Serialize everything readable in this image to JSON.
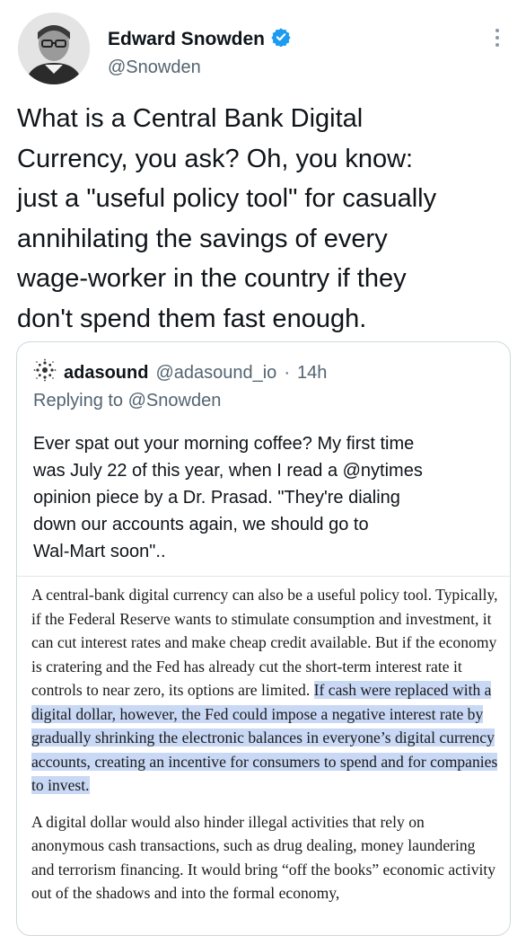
{
  "author": {
    "name": "Edward Snowden",
    "handle": "@Snowden",
    "verified_icon": "verified-badge-icon",
    "colors": {
      "verified": "#1d9bf0"
    }
  },
  "tweet": {
    "text": "What is a Central Bank Digital\nCurrency, you ask? Oh, you know:\njust a \"useful policy tool\" for casually\nannihilating the savings of every\nwage-worker in the country if they\ndon't spend them fast enough."
  },
  "quote": {
    "name": "adasound",
    "handle": "@adasound_io",
    "separator": "·",
    "time": "14h",
    "replying_prefix": "Replying to ",
    "replying_to": "@Snowden",
    "text": "Ever spat out your morning coffee?  My first time\nwas July 22 of this year, when I read a @nytimes\nopinion piece by a Dr. Prasad.  \"They're dialing\ndown our accounts again, we should go to\nWal-Mart soon\".."
  },
  "article": {
    "p1_plain": "A central-bank digital currency can also be a useful policy tool. Typically, if the Federal Reserve wants to stimulate consumption and investment, it can cut interest rates and make cheap credit available. But if the economy is cratering and the Fed has already cut the short-term interest rate it controls to near zero, its options are limited. ",
    "p1_highlight": "If cash were replaced with a digital dollar, however, the Fed could impose a negative interest rate by gradually shrinking the electronic balances in everyone’s digital currency accounts, creating an incentive for consumers to spend and for companies to invest.",
    "p2": "A digital dollar would also hinder illegal activities that rely on anonymous cash transactions, such as drug dealing, money laundering and terrorism financing. It would bring “off the books” economic activity out of the shadows and into the formal economy,"
  }
}
